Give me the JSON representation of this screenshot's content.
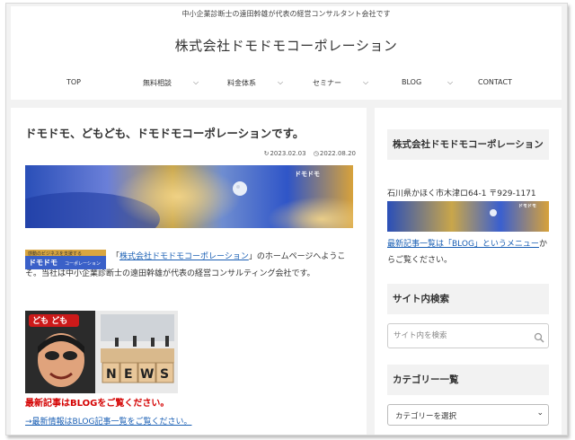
{
  "header": {
    "tagline": "中小企業診断士の遠田幹雄が代表の経営コンサルタント会社です",
    "site_title": "株式会社ドモドモコーポレーション"
  },
  "nav": {
    "items": [
      {
        "label": "TOP",
        "has_dropdown": false
      },
      {
        "label": "無料相談",
        "has_dropdown": true
      },
      {
        "label": "料金体系",
        "has_dropdown": true
      },
      {
        "label": "セミナー",
        "has_dropdown": true
      },
      {
        "label": "BLOG",
        "has_dropdown": true
      },
      {
        "label": "CONTACT",
        "has_dropdown": false
      }
    ],
    "arrow": "⌵"
  },
  "post": {
    "title": "ドモドモ、どもども、ドモドモコーポレーションです。",
    "updated_icon": "refresh-icon",
    "updated": "2023.02.03",
    "published_icon": "clock-icon",
    "published": "2022.08.20",
    "hero_logo_text": "ドモドモ",
    "small_logo_line1": "感動のビジネスを支援する",
    "small_logo_line2": "ドモドモ",
    "small_logo_line3": "コーポレーション",
    "intro_prefix": "「",
    "intro_link": "株式会社ドモドモコーポレーション",
    "intro_suffix": "」のホームページへようこそ。当社は中小企業診断士の遠田幹雄が代表の経営コンサルティング会社です。",
    "news_badge": "ども ども",
    "news_word": [
      "N",
      "E",
      "W",
      "S"
    ],
    "red_notice": "最新記事はBLOGをご覧ください。",
    "blog_link": "→最新情報はBLOG記事一覧をご覧ください。"
  },
  "sidebar": {
    "company_title": "株式会社ドモドモコーポレーション",
    "address": "石川県かほく市木津ロ64-1 〒929-1171",
    "link_text": "最新記事一覧は「BLOG」というメニュー",
    "link_suffix": "からご覧ください。",
    "search_title": "サイト内検索",
    "search_placeholder": "サイト内を検索",
    "category_title": "カテゴリー一覧",
    "category_select": "カテゴリーを選択"
  },
  "colors": {
    "accent_link": "#1a5fb4",
    "notice_red": "#d40000"
  }
}
